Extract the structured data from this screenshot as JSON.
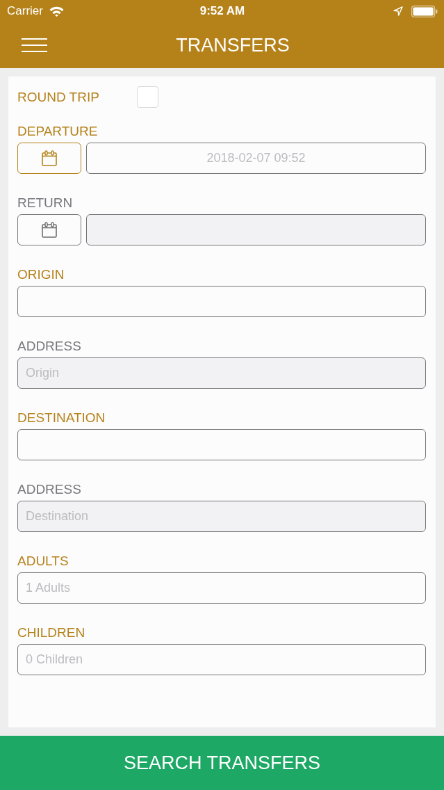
{
  "status_bar": {
    "carrier": "Carrier",
    "time": "9:52 AM"
  },
  "header": {
    "title": "TRANSFERS"
  },
  "round_trip": {
    "label": "ROUND TRIP",
    "checked": false
  },
  "fields": [
    {
      "kind": "date",
      "label": "DEPARTURE",
      "disabled": false,
      "placeholder": "2018-02-07 09:52"
    },
    {
      "kind": "date",
      "label": "RETURN",
      "disabled": true
    },
    {
      "kind": "text",
      "label": "ORIGIN",
      "disabled": false
    },
    {
      "kind": "text",
      "label": "ADDRESS",
      "disabled": true,
      "placeholder": "Origin"
    },
    {
      "kind": "text",
      "label": "DESTINATION",
      "disabled": false
    },
    {
      "kind": "text",
      "label": "ADDRESS",
      "disabled": true,
      "placeholder": "Destination"
    },
    {
      "kind": "text",
      "label": "ADULTS",
      "disabled": false,
      "placeholder": "1 Adults"
    },
    {
      "kind": "text",
      "label": "CHILDREN",
      "disabled": false,
      "placeholder": "0 Children"
    }
  ],
  "search_button": {
    "label": "SEARCH TRANSFERS"
  }
}
